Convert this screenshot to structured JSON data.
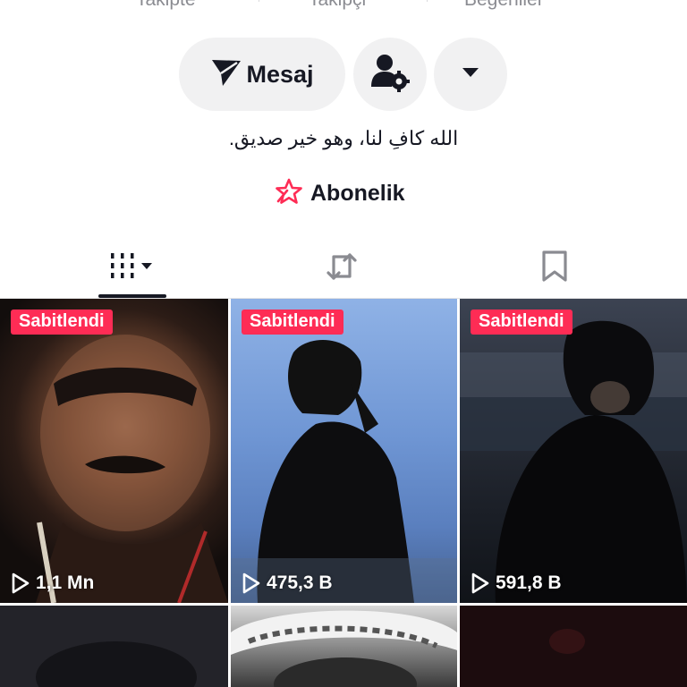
{
  "stats": [
    {
      "label": "Takipte"
    },
    {
      "label": "Takipçi"
    },
    {
      "label": "Beğeniler"
    }
  ],
  "actions": {
    "message_label": "Mesaj",
    "add_friend_icon": "person-gear-icon",
    "more_icon": "caret-down-icon"
  },
  "bio": "الله كافِ لنا، وهو خير صديق.",
  "subscription": {
    "label": "Abonelik",
    "icon": "star-badge-icon",
    "color": "#fe2c55"
  },
  "tabs": [
    {
      "name": "videos",
      "icon": "grid-icon",
      "active": true
    },
    {
      "name": "reposts",
      "icon": "repost-icon",
      "active": false
    },
    {
      "name": "saved",
      "icon": "bookmark-icon",
      "active": false
    }
  ],
  "videos": [
    {
      "pinned_label": "Sabitlendi",
      "views": "1,1 Mn"
    },
    {
      "pinned_label": "Sabitlendi",
      "views": "475,3 B"
    },
    {
      "pinned_label": "Sabitlendi",
      "views": "591,8 B"
    },
    {},
    {},
    {}
  ],
  "colors": {
    "accent": "#fe2c55",
    "text": "#161823",
    "muted": "#8a8b91",
    "button_bg": "#f1f1f2"
  }
}
